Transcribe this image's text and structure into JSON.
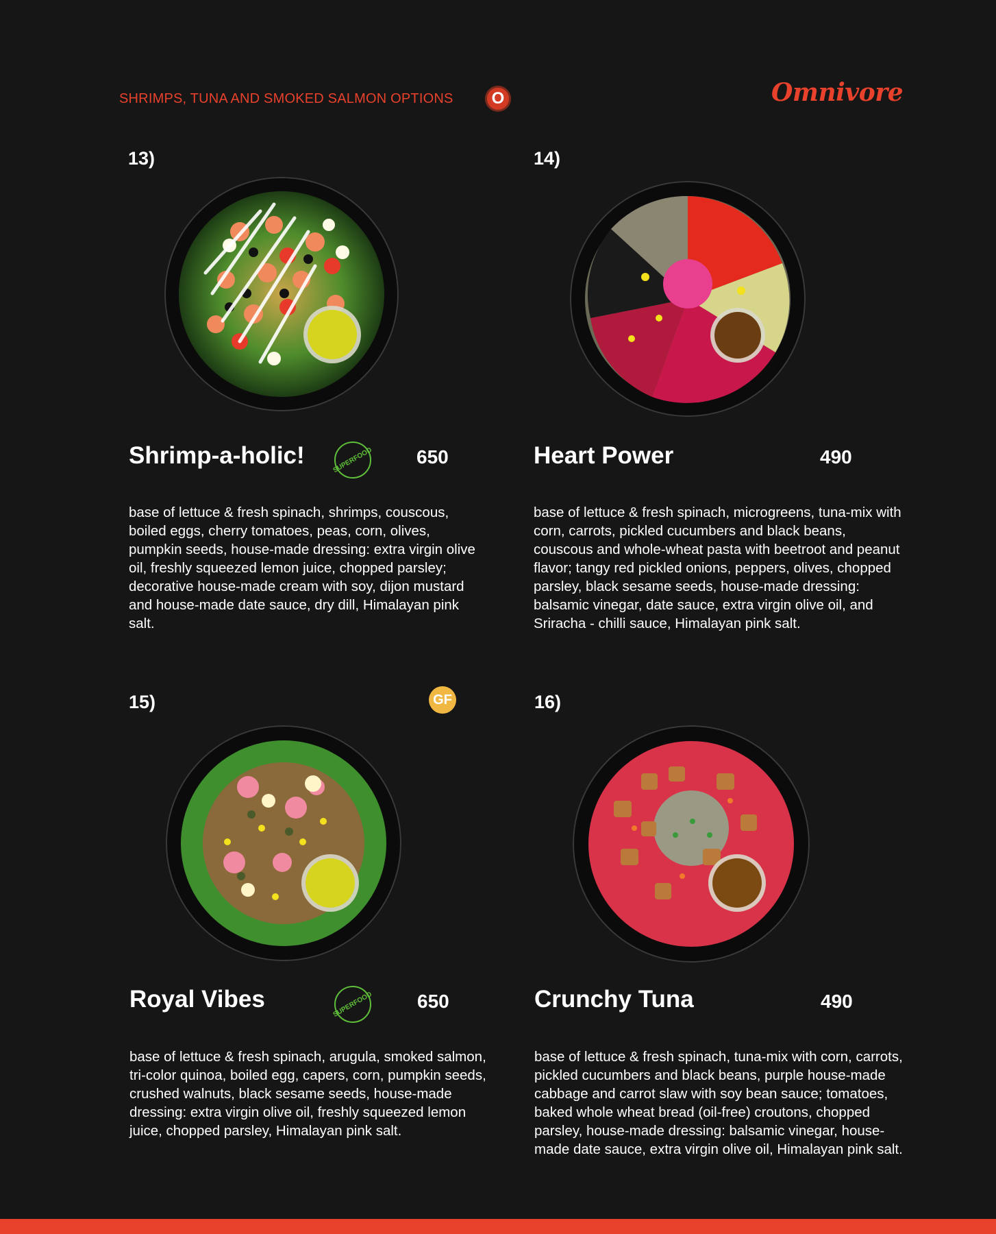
{
  "header": {
    "section_title": "SHRIMPS, TUNA AND SMOKED SALMON OPTIONS",
    "badge_letter": "O",
    "brand": "Omnivore"
  },
  "colors": {
    "background": "#161616",
    "accent": "#e8412c",
    "superfood_green": "#5fbf3a",
    "gf_gold": "#f0b843"
  },
  "items": [
    {
      "number": "13)",
      "name": "Shrimp-a-holic!",
      "price": "650",
      "badge": "SUPERFOOD",
      "description": "base of lettuce & fresh spinach, shrimps, couscous, boiled eggs, cherry tomatoes, peas, corn, olives, pumpkin seeds, house-made dressing: extra virgin olive oil, freshly squeezed lemon juice, chopped parsley; decorative house-made cream with soy, dijon mustard and house-made date sauce, dry dill, Himalayan pink salt."
    },
    {
      "number": "14)",
      "name": "Heart Power",
      "price": "490",
      "description": "base of lettuce & fresh spinach, microgreens, tuna-mix with corn, carrots, pickled cucumbers and black beans, couscous and whole-wheat pasta with beetroot and peanut flavor; tangy red pickled onions, peppers, olives, chopped parsley, black sesame seeds, house-made dressing: balsamic vinegar, date sauce, extra virgin olive oil, and Sriracha - chilli sauce, Himalayan pink salt."
    },
    {
      "number": "15)",
      "name": "Royal Vibes",
      "price": "650",
      "badge": "SUPERFOOD",
      "gf_badge": "GF",
      "description": "base of lettuce & fresh spinach, arugula, smoked salmon, tri-color quinoa, boiled egg, capers, corn, pumpkin seeds, crushed walnuts, black sesame seeds, house-made dressing: extra virgin olive oil, freshly squeezed lemon juice, chopped parsley, Himalayan pink salt."
    },
    {
      "number": "16)",
      "name": "Crunchy Tuna",
      "price": "490",
      "description": "base of lettuce & fresh spinach, tuna-mix with corn, carrots, pickled cucumbers and black beans, purple house-made cabbage and carrot slaw with soy bean sauce; tomatoes, baked whole wheat bread (oil-free) croutons, chopped parsley, house-made dressing: balsamic vinegar, house-made date sauce, extra virgin olive oil, Himalayan pink salt."
    }
  ]
}
